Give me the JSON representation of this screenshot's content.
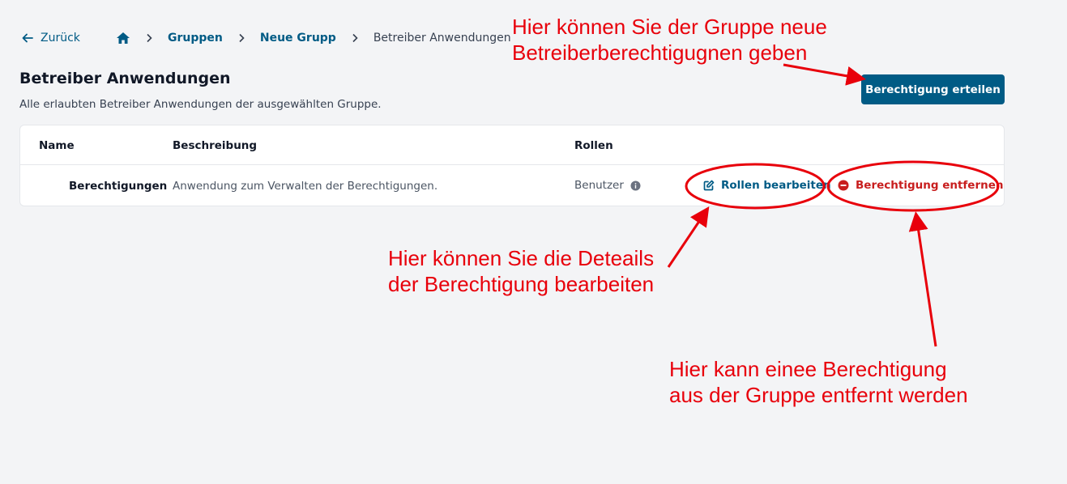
{
  "nav": {
    "back_label": "Zurück",
    "breadcrumbs": [
      {
        "label": "Gruppen"
      },
      {
        "label": "Neue Grupp"
      },
      {
        "label": "Betreiber Anwendungen"
      }
    ]
  },
  "header": {
    "title": "Betreiber Anwendungen",
    "subtitle": "Alle erlaubten Betreiber Anwendungen der ausgewählten Gruppe.",
    "grant_button": "Berechtigung erteilen"
  },
  "table": {
    "columns": [
      "Name",
      "Beschreibung",
      "Rollen"
    ],
    "rows": [
      {
        "name": "Berechtigungen",
        "description": "Anwendung zum Verwalten der Berechtigungen.",
        "roles": "Benutzer",
        "edit_label": "Rollen bearbeiten",
        "remove_label": "Berechtigung entfernen"
      }
    ]
  },
  "annotations": {
    "grant": [
      "Hier können Sie der Gruppe neue",
      "Betreiberberechtigugnen geben"
    ],
    "edit": [
      "Hier können Sie die Deteails",
      "der Berechtigung bearbeiten"
    ],
    "remove": [
      "Hier kann einee Berechtigung",
      "aus der Gruppe entfernt werden"
    ]
  },
  "colors": {
    "primary": "#005b85",
    "danger": "#c81e1e",
    "annotation": "#e8000b",
    "background": "#f3f4f6"
  }
}
